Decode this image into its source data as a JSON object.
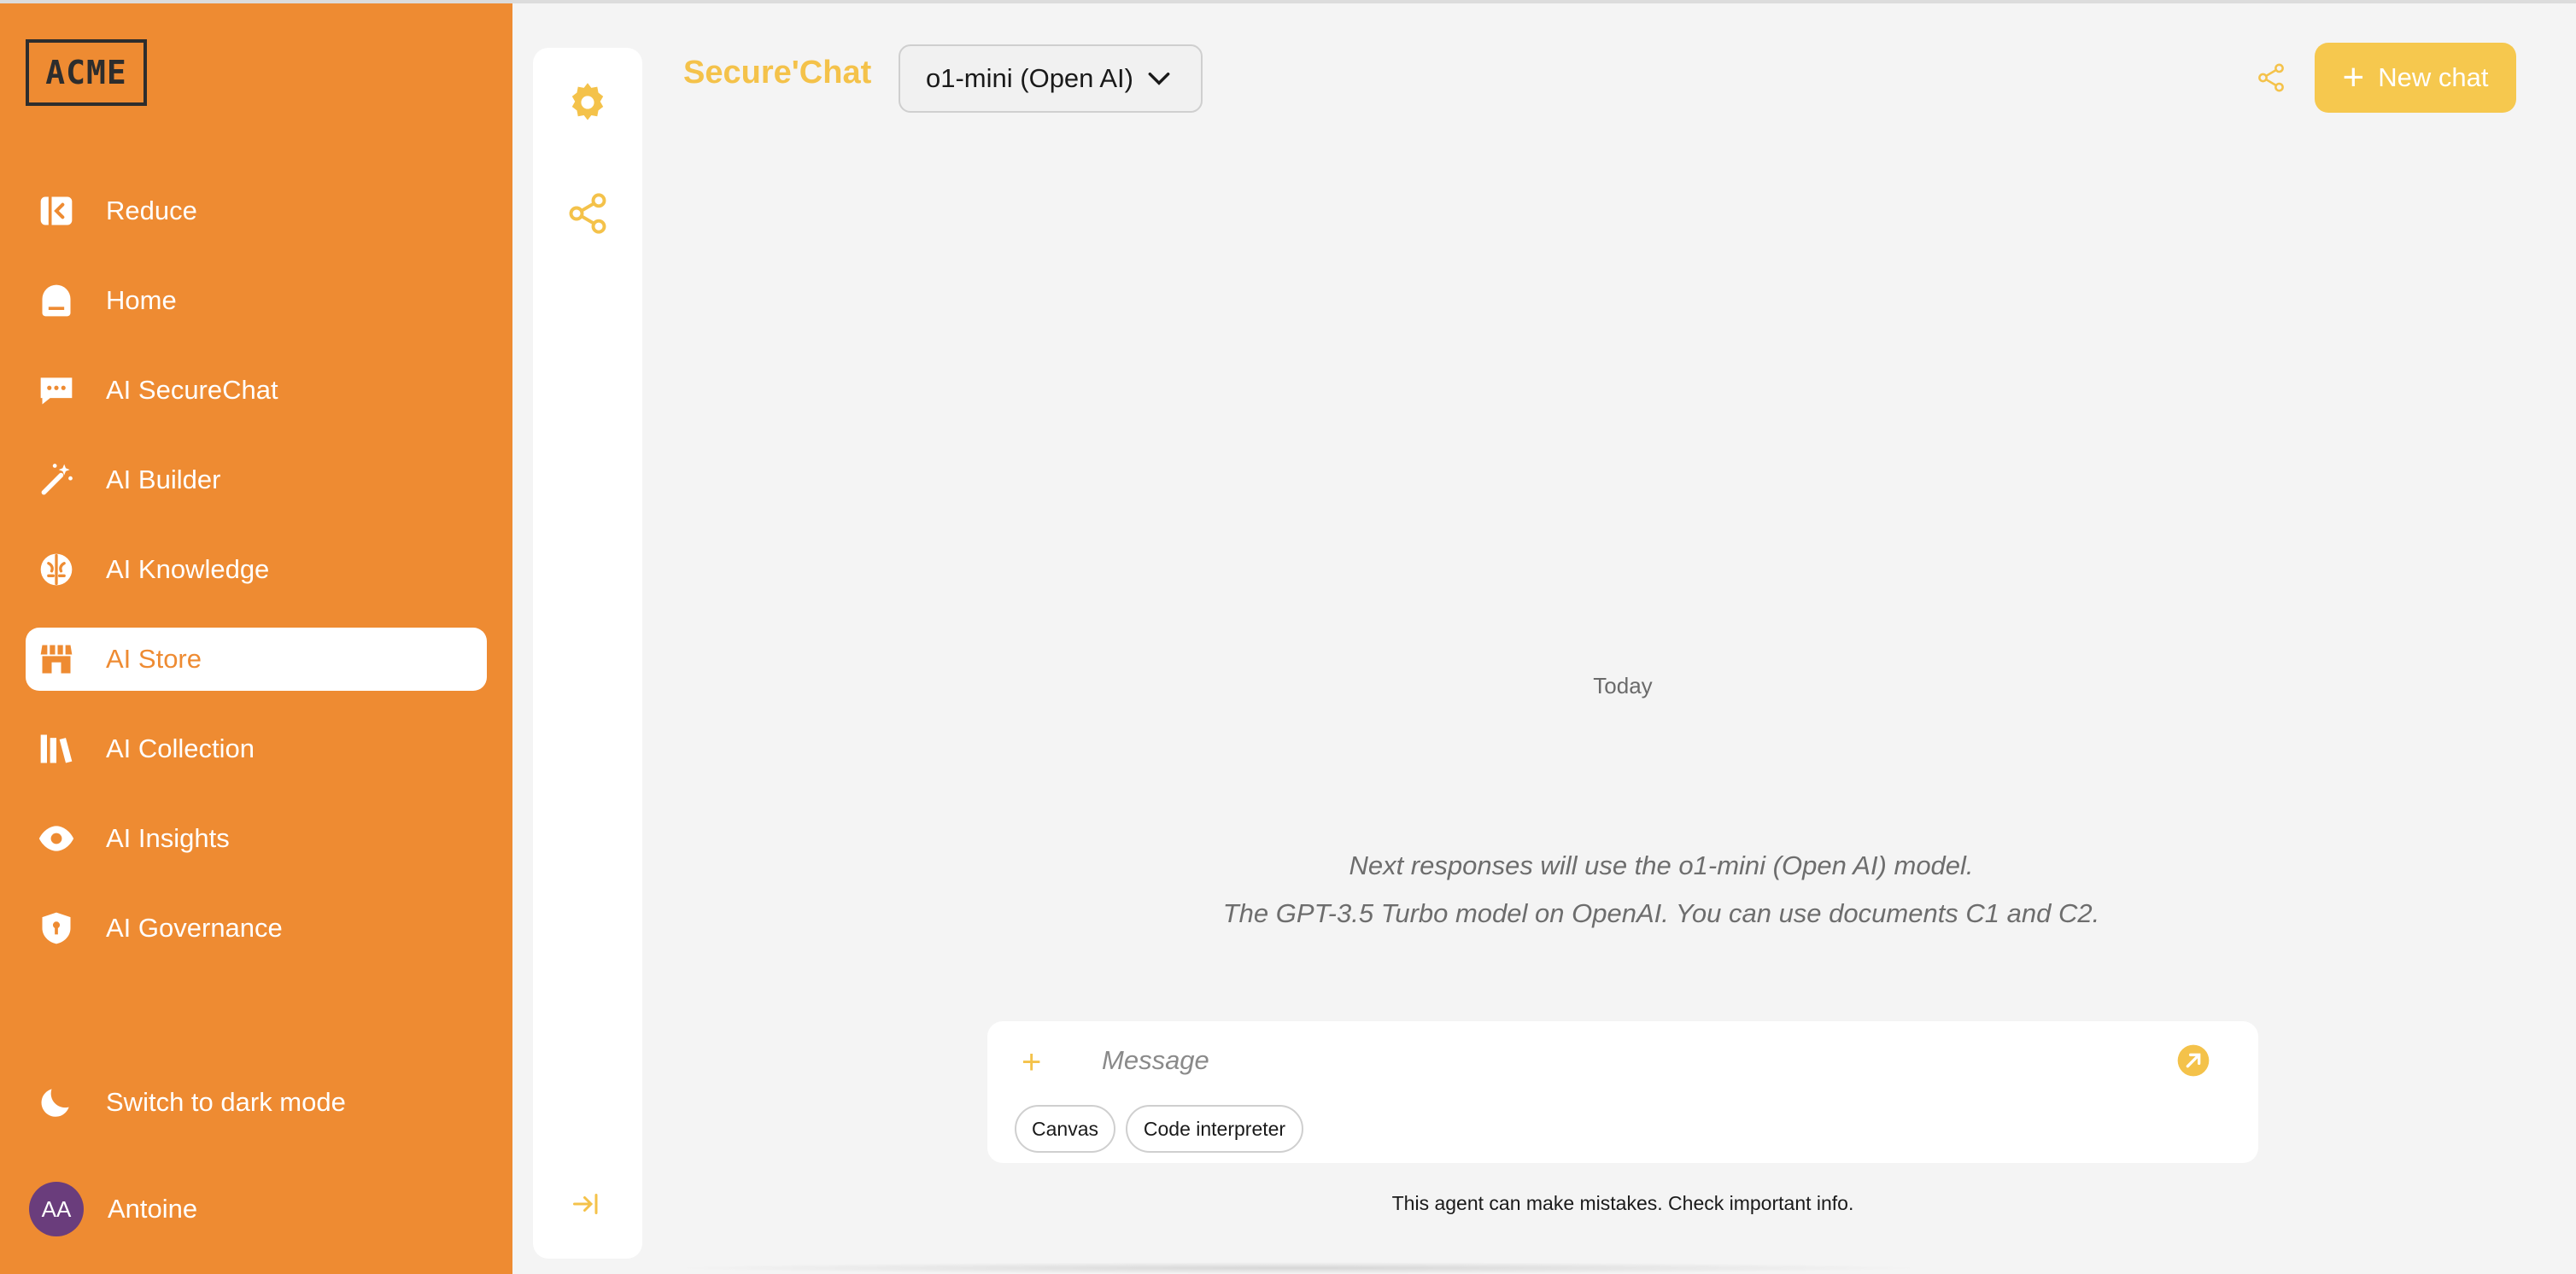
{
  "sidebar": {
    "logo": "ACME",
    "items": [
      {
        "label": "Reduce",
        "icon": "collapse-sidebar-icon"
      },
      {
        "label": "Home",
        "icon": "home-icon"
      },
      {
        "label": "AI SecureChat",
        "icon": "chat-bubble-icon"
      },
      {
        "label": "AI Builder",
        "icon": "magic-wand-icon"
      },
      {
        "label": "AI Knowledge",
        "icon": "brain-icon"
      },
      {
        "label": "AI Store",
        "icon": "store-icon",
        "active": true
      },
      {
        "label": "AI Collection",
        "icon": "books-icon"
      },
      {
        "label": "AI Insights",
        "icon": "eye-icon"
      },
      {
        "label": "AI Governance",
        "icon": "shield-icon"
      }
    ],
    "dark_mode_label": "Switch to dark mode",
    "user": {
      "initials": "AA",
      "name": "Antoine"
    }
  },
  "header": {
    "brand": "Secure'Chat",
    "model": "o1-mini (Open AI)",
    "new_chat_label": "New chat"
  },
  "chat": {
    "date_divider": "Today",
    "notices": [
      "Next responses will use the o1-mini (Open AI) model.",
      "The GPT-3.5 Turbo model on OpenAI. You can use documents C1 and C2."
    ]
  },
  "composer": {
    "placeholder": "Message",
    "chips": [
      "Canvas",
      "Code interpreter"
    ]
  },
  "disclaimer": "This agent can make mistakes. Check important info.",
  "colors": {
    "sidebar": "#ee8b32",
    "accent": "#f4c24a",
    "button": "#f6c84e",
    "avatar": "#6a3d7c"
  }
}
